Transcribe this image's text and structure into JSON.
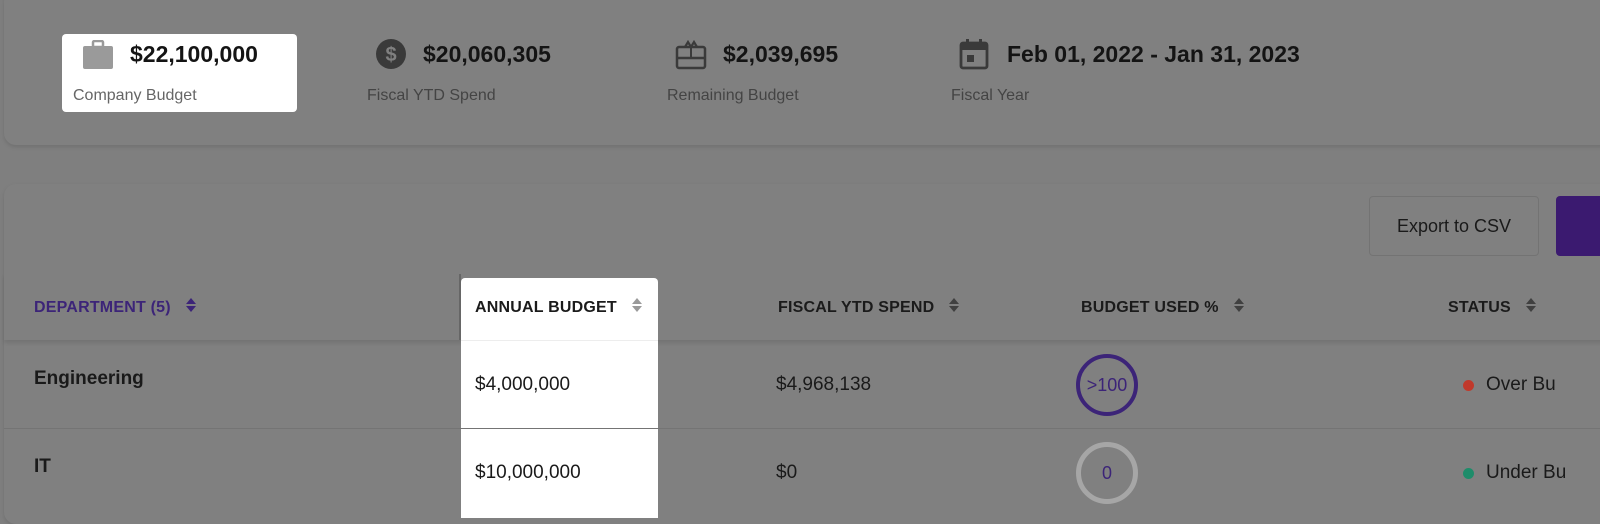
{
  "summary": {
    "company_budget": {
      "value": "$22,100,000",
      "label": "Company Budget",
      "icon": "briefcase-icon"
    },
    "fiscal_ytd_spend": {
      "value": "$20,060,305",
      "label": "Fiscal YTD Spend",
      "icon": "dollar-circle-icon"
    },
    "remaining_budget": {
      "value": "$2,039,695",
      "label": "Remaining Budget",
      "icon": "gift-card-icon"
    },
    "fiscal_year": {
      "value": "Feb 01, 2022 - Jan 31, 2023",
      "label": "Fiscal Year",
      "icon": "calendar-icon"
    }
  },
  "toolbar": {
    "export_label": "Export to CSV"
  },
  "table": {
    "columns": [
      {
        "key": "department",
        "label": "DEPARTMENT (5)"
      },
      {
        "key": "annual_budget",
        "label": "ANNUAL BUDGET"
      },
      {
        "key": "fiscal_ytd_spend",
        "label": "FISCAL YTD SPEND"
      },
      {
        "key": "budget_used",
        "label": "BUDGET USED %"
      },
      {
        "key": "status",
        "label": "STATUS"
      }
    ],
    "rows": [
      {
        "department": "Engineering",
        "annual_budget": "$4,000,000",
        "fiscal_ytd_spend": "$4,968,138",
        "budget_used": ">100",
        "status": "Over Bu",
        "status_color": "#c0392b"
      },
      {
        "department": "IT",
        "annual_budget": "$10,000,000",
        "fiscal_ytd_spend": "$0",
        "budget_used": "0",
        "status": "Under Bu",
        "status_color": "#1e8c6a"
      }
    ]
  },
  "colors": {
    "accent": "#3c2478",
    "primary_button": "#3b1a70"
  }
}
